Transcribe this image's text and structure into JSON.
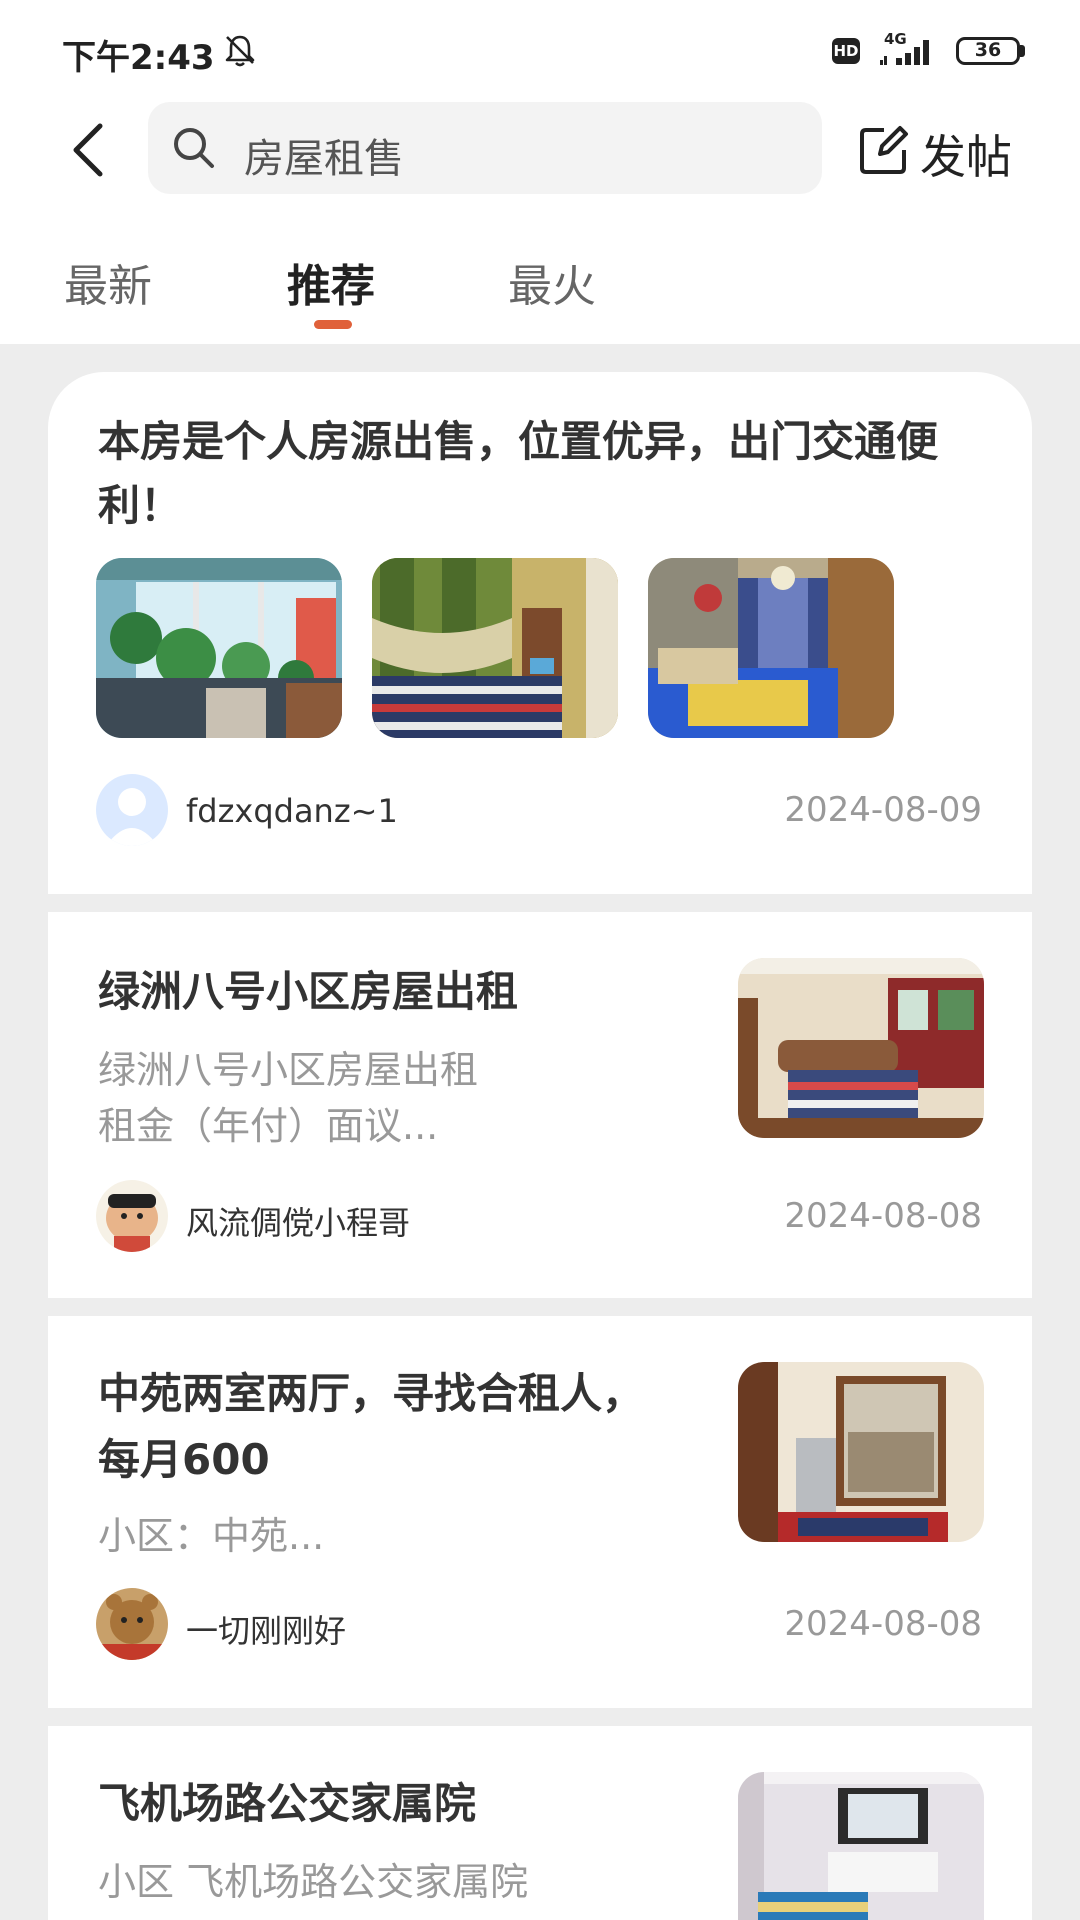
{
  "status_bar": {
    "time": "下午2:43",
    "hd": "HD",
    "network": "4G",
    "battery": "36",
    "battery_level": 0.36
  },
  "header": {
    "search_text": "房屋租售",
    "post_label": "发帖"
  },
  "tabs": [
    {
      "label": "最新",
      "active": false
    },
    {
      "label": "推荐",
      "active": true
    },
    {
      "label": "最火",
      "active": false
    }
  ],
  "accent_color": "#e0613a",
  "posts": [
    {
      "title": "本房是个人房源出售，位置优异，出门交通便利！",
      "author": "fdzxqdanz~1",
      "date": "2024-08-09",
      "images": [
        "balcony-plants-photo",
        "bedroom-green-curtain-photo",
        "living-room-blue-carpet-photo"
      ]
    },
    {
      "title": "绿洲八号小区房屋出租",
      "desc_line1": "绿洲八号小区房屋出租",
      "desc_line2": "租金（年付）面议...",
      "author": "风流倜傥小程哥",
      "date": "2024-08-08"
    },
    {
      "title_line1": "中苑两室两厅，寻找合租人，",
      "title_line2": "每月600",
      "desc": "小区：中苑...",
      "author": "一切刚刚好",
      "date": "2024-08-08"
    },
    {
      "title": "飞机场路公交家属院",
      "desc": "小区 飞机场路公交家属院"
    }
  ]
}
